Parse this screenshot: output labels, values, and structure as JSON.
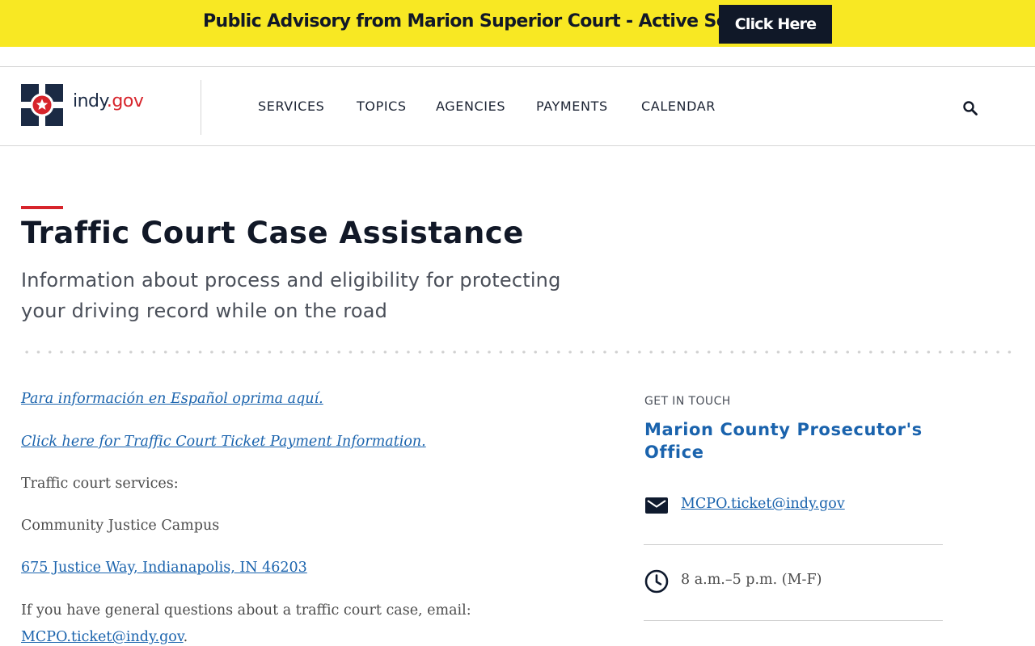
{
  "advisory": {
    "text": "Public Advisory from Marion Superior Court - Active Scams",
    "button_label": "Click Here",
    "background_color": "#f8e823"
  },
  "header": {
    "logo_indy": "indy",
    "logo_dot": ".",
    "logo_gov": "gov",
    "nav": [
      "SERVICES",
      "TOPICS",
      "AGENCIES",
      "PAYMENTS",
      "CALENDAR"
    ],
    "search_icon": "search-icon"
  },
  "page": {
    "title": "Traffic Court Case Assistance",
    "subtitle": "Information about process and eligibility for protecting your driving record while on the road"
  },
  "content": {
    "spanish_link": "Para información en Español oprima aquí.",
    "payment_link": "Click here for Traffic Court Ticket Payment Information.",
    "services_label": "Traffic court services:",
    "campus": "Community Justice Campus",
    "address_link": "675 Justice Way, Indianapolis, IN 46203",
    "questions_text": "If you have general questions about a traffic court case, email:",
    "email_link": "MCPO.ticket@indy.gov",
    "email_suffix": "."
  },
  "aside": {
    "label": "GET IN TOUCH",
    "org": "Marion County Prosecutor's Office",
    "email": "MCPO.ticket@indy.gov",
    "hours": "8 a.m.–5 p.m. (M-F)",
    "email_icon": "mail-icon",
    "hours_icon": "clock-icon"
  },
  "colors": {
    "accent_red": "#d7242b",
    "link_blue": "#1a63ad",
    "navy": "#1b2a44"
  }
}
